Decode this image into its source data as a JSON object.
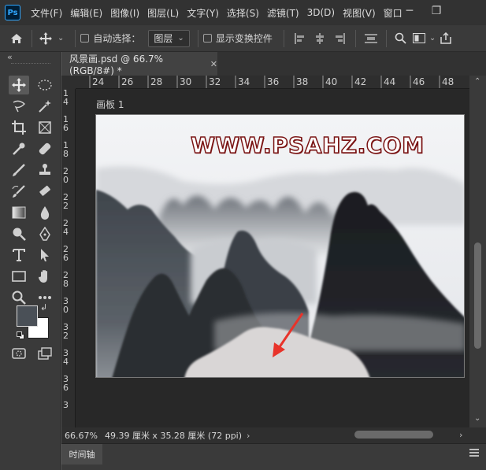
{
  "app": {
    "logo": "Ps"
  },
  "menu": [
    "文件(F)",
    "编辑(E)",
    "图像(I)",
    "图层(L)",
    "文字(Y)",
    "选择(S)",
    "滤镜(T)",
    "3D(D)",
    "视图(V)",
    "窗口"
  ],
  "window_controls": {
    "minimize": "─",
    "restore": "❐"
  },
  "options": {
    "auto_select_label": "自动选择：",
    "layer_select_value": "图层",
    "show_transform_label": "显示变换控件"
  },
  "document_tab": {
    "title": "风景画.psd @ 66.7%(RGB/8#) *",
    "close": "✕"
  },
  "ruler_h": [
    "24",
    "26",
    "28",
    "30",
    "32",
    "34",
    "36",
    "38",
    "40",
    "42",
    "44",
    "46",
    "48"
  ],
  "ruler_v": [
    "1\n4",
    "1\n6",
    "1\n8",
    "2\n0",
    "2\n2",
    "2\n4",
    "2\n6",
    "2\n8",
    "3\n0",
    "3\n2",
    "3\n4",
    "3\n6",
    "3"
  ],
  "artboard": {
    "label": "画板 1",
    "watermark": "WWW.PSAHZ.COM"
  },
  "status": {
    "zoom": "66.67%",
    "doc_size": "49.39 厘米 x 35.28 厘米 (72 ppi)",
    "arrow": "›"
  },
  "timeline": {
    "tab": "时间轴"
  },
  "colors": {
    "foreground": "#4a5057",
    "background": "#ffffff",
    "arrow_annotation": "#e8332a"
  },
  "icons": [
    "home-icon",
    "move-icon",
    "align-icons",
    "search-icon",
    "frame-icon",
    "share-icon",
    "move-tool-icon",
    "marquee-icon",
    "lasso-icon",
    "magic-wand-icon",
    "crop-icon",
    "frame-tool-icon",
    "eyedropper-icon",
    "healing-icon",
    "brush-icon",
    "stamp-icon",
    "history-brush-icon",
    "eraser-icon",
    "gradient-icon",
    "blur-icon",
    "dodge-icon",
    "pen-icon",
    "type-icon",
    "path-select-icon",
    "rectangle-icon",
    "hand-icon",
    "zoom-icon",
    "more-icon",
    "quickmask-icon",
    "screenmode-icon"
  ]
}
